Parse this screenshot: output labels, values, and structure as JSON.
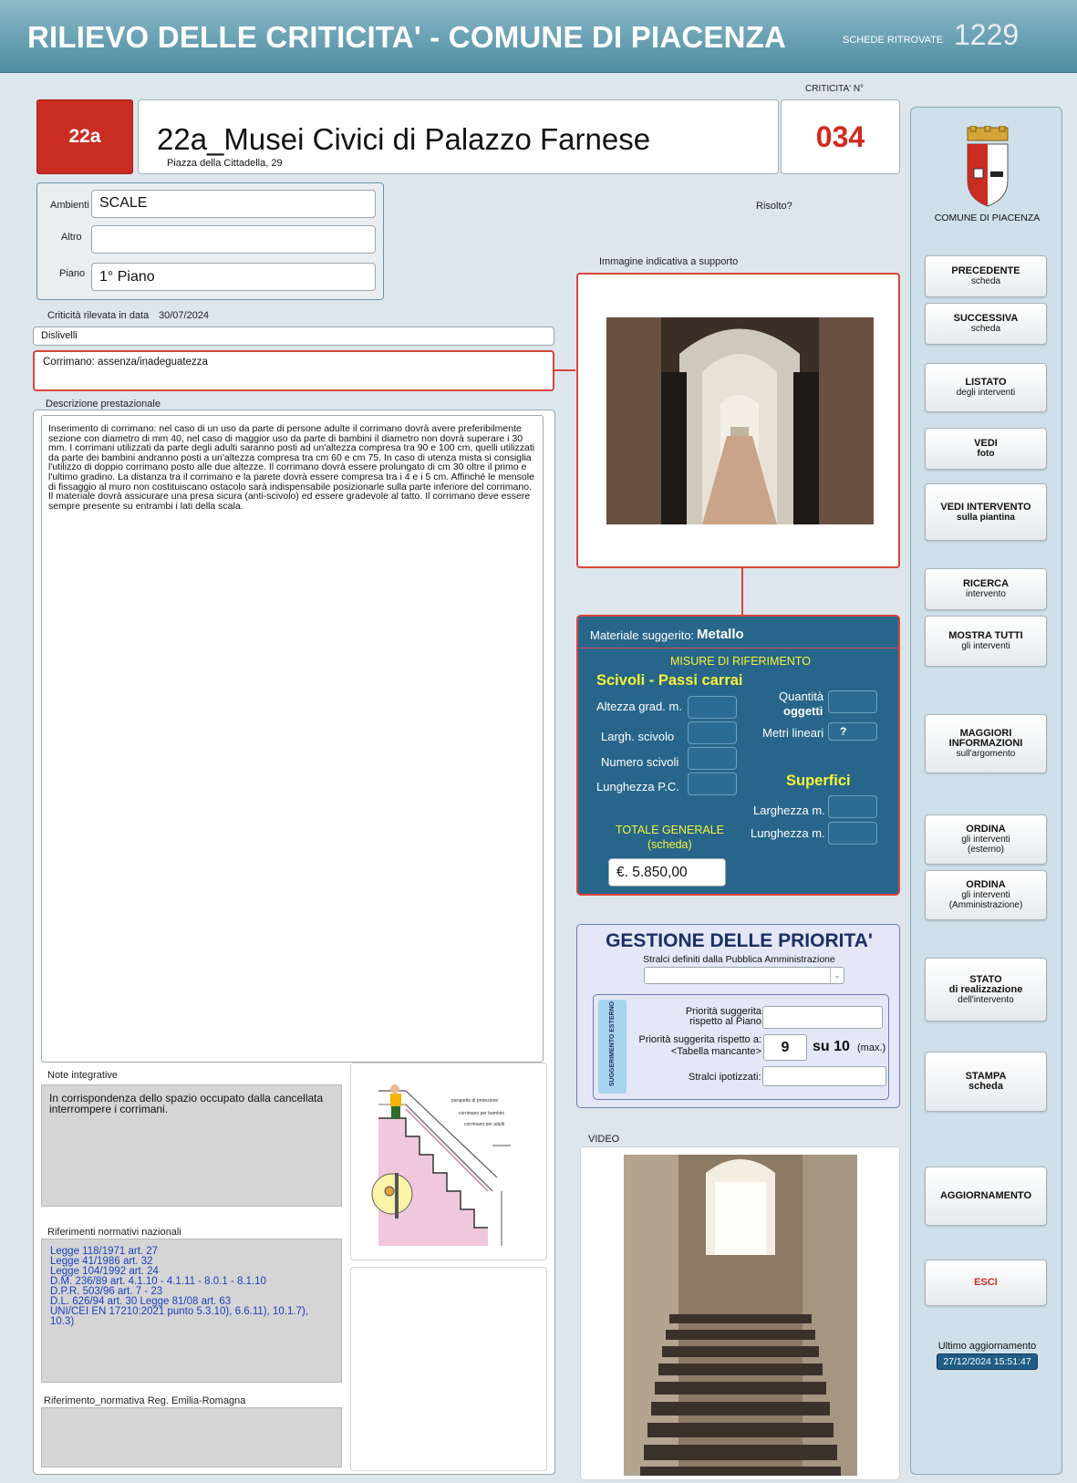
{
  "header": {
    "title": "RILIEVO DELLE CRITICITA' - COMUNE DI PIACENZA",
    "schede_label": "SCHEDE RITROVATE",
    "schede_count": "1229"
  },
  "record": {
    "code": "22a",
    "title": "22a_Musei Civici di Palazzo Farnese",
    "address": "Piazza della Cittadella, 29",
    "criticita_label": "CRITICITA' N°",
    "criticita_num": "034",
    "risolto_label": "Risolto?"
  },
  "location": {
    "ambienti_label": "Ambienti",
    "ambienti_value": "SCALE",
    "altro_label": "Altro",
    "altro_value": "",
    "piano_label": "Piano",
    "piano_value": "1° Piano"
  },
  "detection": {
    "date_label": "Criticità rilevata in data",
    "date_value": "30/07/2024",
    "category": "Dislivelli",
    "issue": "Corrimano: assenza/inadeguatezza"
  },
  "description": {
    "label": "Descrizione  prestazionale",
    "text": "Inserimento di corrimano: nel caso di un uso da parte di persone adulte il corrimano dovrà avere preferibilmente sezione con diametro di mm 40, nel caso di maggior uso da parte di bambini il diametro non dovrà superare i 30 mm. I corrimani utilizzati da parte degli adulti saranno posti ad un'altezza compresa tra 90 e 100 cm, quelli utilizzati da parte dei bambini andranno posti a un'altezza compresa tra cm 60 e cm 75. In caso di utenza mista si consiglia l'utilizzo di doppio corrimano posto alle due altezze. Il corrimano dovrà essere prolungato di cm 30 oltre il primo e l'ultimo gradino.  La distanza tra il corrimano e la parete dovrà essere compresa tra i 4 e i 5 cm. Affinché le mensole di fissaggio al muro non costituiscano ostacolo sarà indispensabile posizionarle sulla parte inferiore del corrimano. Il materiale dovrà assicurare una presa sicura (anti-scivolo) ed essere gradevole al tatto. Il corrimano deve essere sempre presente su entrambi i lati della scala."
  },
  "notes": {
    "label": "Note integrative",
    "text": "In corrispondenza dello spazio occupato dalla cancellata interrompere i corrimani."
  },
  "diagram": {
    "label_1": "parapetto di protezione",
    "label_2": "corrimano per bambini",
    "label_3": "corrimano per adulti"
  },
  "norms_national": {
    "label": "Riferimenti normativi nazionali",
    "lines": [
      "Legge 118/1971 art. 27",
      "Legge 41/1986 art. 32",
      "Legge 104/1992 art. 24",
      "D.M. 236/89 art. 4.1.10 - 4.1.11 - 8.0.1 - 8.1.10",
      "D.P.R. 503/96 art. 7 - 23",
      "D.L. 626/94 art. 30   Legge 81/08 art. 63",
      "UNI/CEI EN 17210:2021  punto 5.3.10), 6.6.11), 10.1.7), 10.3)"
    ]
  },
  "norms_regional": {
    "label": "Riferimento_normativa Reg. Emilia-Romagna"
  },
  "image_section": {
    "label": "Immagine indicativa a supporto"
  },
  "material": {
    "label": "Materiale suggerito:",
    "value": "Metallo",
    "misure_title": "MISURE DI RIFERIMENTO",
    "scivoli_title": "Scivoli - Passi carrai",
    "altezza_label": "Altezza grad. m.",
    "largh_label": "Largh.  scivolo",
    "numero_label": "Numero scivoli",
    "lunghezza_pc_label": "Lunghezza P.C.",
    "quantita_label": "Quantità",
    "oggetti_label": "oggetti",
    "metri_label": "Metri lineari",
    "metri_value": "?",
    "superfici_title": "Superfici",
    "larghezza_label": "Larghezza m.",
    "lunghezza_label": "Lunghezza m.",
    "totale_label": "TOTALE GENERALE",
    "totale_sub": "(scheda)",
    "totale_value": "€.  5.850,00"
  },
  "priority": {
    "title": "GESTIONE DELLE PRIORITA'",
    "subtitle": "Stralci definiti dalla Pubblica Amministrazione",
    "side_tag": "SUGGERIMENTO ESTERNO",
    "piano_label_1": "Priorità suggerita",
    "piano_label_2": "rispetto al Piano",
    "rispetto_label_1": "Priorità suggerita rispetto a:",
    "rispetto_label_2": "<Tabella mancante>",
    "score": "9",
    "score_of": "su 10",
    "score_max": "(max.)",
    "stralci_label": "Stralci ipotizzati:"
  },
  "video": {
    "label": "VIDEO"
  },
  "sidebar": {
    "comune": "COMUNE DI PIACENZA",
    "buttons": [
      {
        "title": "PRECEDENTE",
        "sub": "scheda"
      },
      {
        "title": "SUCCESSIVA",
        "sub": "scheda"
      },
      {
        "title": "LISTATO",
        "sub": "degli interventi"
      },
      {
        "title": "VEDI",
        "sub": "foto"
      },
      {
        "title": "VEDI INTERVENTO",
        "sub": "sulla piantina"
      },
      {
        "title": "RICERCA",
        "sub": "intervento"
      },
      {
        "title": "MOSTRA TUTTI",
        "sub": "gli interventi"
      },
      {
        "title": "MAGGIORI",
        "title2": "INFORMAZIONI",
        "sub": "sull'argomento"
      },
      {
        "title": "ORDINA",
        "sub": "gli interventi",
        "sub2": "(esterno)"
      },
      {
        "title": "ORDINA",
        "sub": "gli interventi",
        "sub2": "(Amministrazione)"
      },
      {
        "title": "STATO",
        "title2": "di realizzazione",
        "sub": "dell'intervento"
      },
      {
        "title": "STAMPA",
        "title2": "scheda"
      },
      {
        "title": "AGGIORNAMENTO"
      },
      {
        "title": "ESCI"
      }
    ],
    "last_update_label": "Ultimo aggiornamento",
    "last_update_value": "27/12/2024 15:51:47"
  },
  "colors": {
    "accent_red": "#c92c21",
    "panel_blue": "#27668a",
    "header_teal": "#5f9bb0"
  }
}
